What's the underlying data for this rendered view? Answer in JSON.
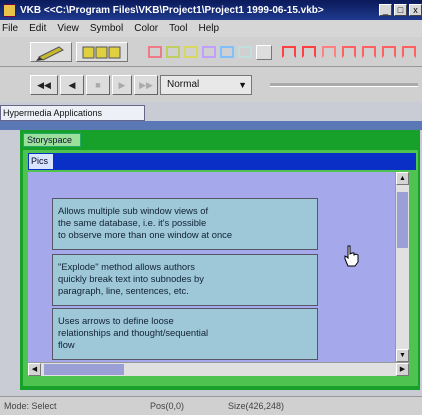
{
  "window": {
    "title": "VKB  <<C:\\Program Files\\VKB\\Project1\\Project1 1999-06-15.vkb>  ",
    "minimize": "_",
    "maximize": "□",
    "close": "x"
  },
  "menu": [
    "File",
    "Edit",
    "View",
    "Symbol",
    "Color",
    "Tool",
    "Help"
  ],
  "colors": {
    "title_bar": "#0a1a5a",
    "story_frame": "#17a12b",
    "pics_bar": "#0a2fc7",
    "canvas": "#a5a9ec",
    "note_fill": "#9ec8d8",
    "swatches": [
      "#f07a8a",
      "#c0d060",
      "#d8d860",
      "#c0a0ff",
      "#80c0ff",
      "#c0e0e0",
      "#ff4040",
      "#ff8080",
      "#ff6060"
    ]
  },
  "media_controls": {
    "buttons": [
      "rewind-fast",
      "step-back",
      "stop",
      "play",
      "fast-forward"
    ],
    "speed": "Normal"
  },
  "tab": "Hypermedia Applications",
  "storyspace": "Storyspace",
  "pics_label": "Pics",
  "notes": [
    {
      "text": "Allows multiple sub window views of\nthe same database, i.e. it's possible\nto observe more than one window at once"
    },
    {
      "text": "\"Explode\" method allows authors\nquickly break text into subnodes by\nparagraph, line, sentences, etc."
    },
    {
      "text": "Uses arrows to define loose\nrelationships and thought/sequential\nflow"
    }
  ],
  "status": {
    "mode": "Mode: Select",
    "pos": "Pos(0,0)",
    "size": "Size(426,248)"
  }
}
